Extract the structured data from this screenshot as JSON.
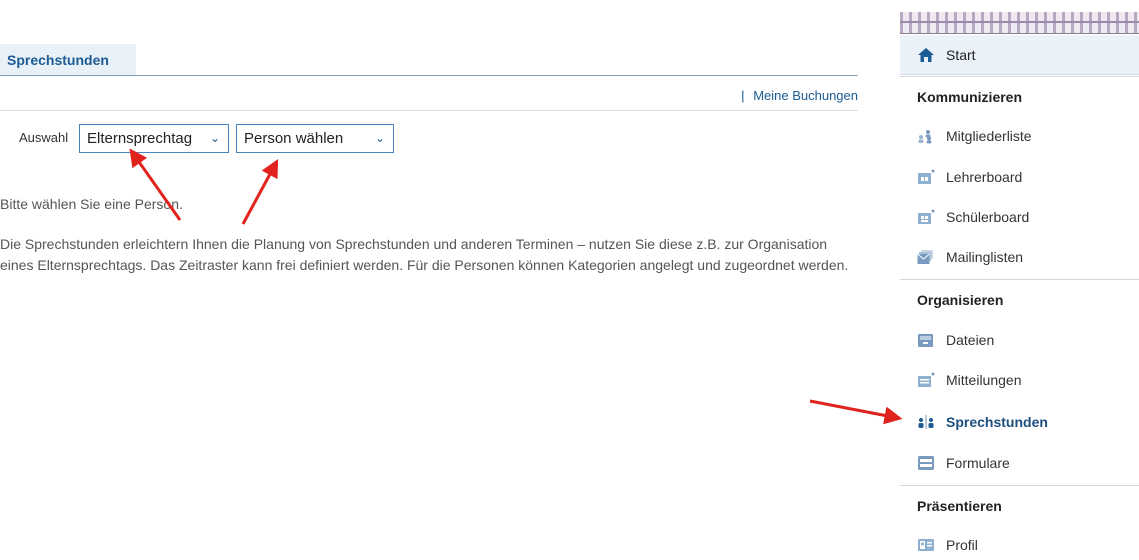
{
  "main": {
    "tab_label": "Sprechstunden",
    "top_separator": "|",
    "top_link": "Meine Buchungen",
    "selection_label": "Auswahl",
    "select_event": "Elternsprechtag",
    "select_person": "Person wählen",
    "hint": "Bitte wählen Sie eine Person.",
    "description": "Die Sprechstunden erleichtern Ihnen die Planung von Sprechstunden und anderen Terminen – nutzen Sie diese z.B. zur Organisation eines Elternsprechtags. Das Zeitraster kann frei definiert werden. Für die Personen können Kategorien angelegt und zugeordnet werden."
  },
  "sidebar": {
    "start": "Start",
    "section_communicate": "Kommunizieren",
    "mitgliederliste": "Mitgliederliste",
    "lehrerboard": "Lehrerboard",
    "schuelerboard": "Schülerboard",
    "mailinglisten": "Mailinglisten",
    "section_organize": "Organisieren",
    "dateien": "Dateien",
    "mitteilungen": "Mitteilungen",
    "sprechstunden": "Sprechstunden",
    "formulare": "Formulare",
    "section_present": "Präsentieren",
    "profil": "Profil"
  },
  "colors": {
    "accent": "#1c5b93",
    "arrow": "#e0231c",
    "icon": "#7a9bbf"
  }
}
